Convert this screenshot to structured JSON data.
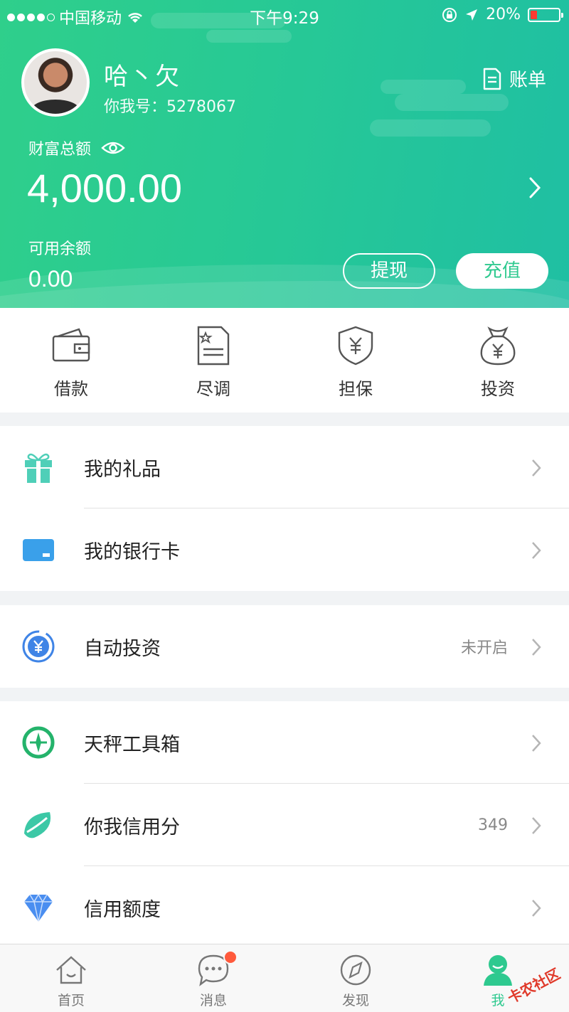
{
  "status_bar": {
    "carrier": "中国移动",
    "time": "下午9:29",
    "battery": "20%"
  },
  "profile": {
    "username": "哈丶欠",
    "user_id": "你我号：5278067",
    "bill_label": "账单"
  },
  "wealth": {
    "label": "财富总额",
    "amount": "4,000.00",
    "available_label": "可用余额",
    "available_amount": "0.00"
  },
  "actions": {
    "withdraw": "提现",
    "recharge": "充值"
  },
  "quick_actions": [
    {
      "label": "借款",
      "icon": "wallet-icon"
    },
    {
      "label": "尽调",
      "icon": "document-star-icon"
    },
    {
      "label": "担保",
      "icon": "shield-yuan-icon"
    },
    {
      "label": "投资",
      "icon": "money-bag-icon"
    }
  ],
  "menu_groups": [
    [
      {
        "label": "我的礼品",
        "icon": "gift-icon",
        "value": ""
      },
      {
        "label": "我的银行卡",
        "icon": "bank-card-icon",
        "value": ""
      }
    ],
    [
      {
        "label": "自动投资",
        "icon": "auto-invest-icon",
        "value": "未开启"
      }
    ],
    [
      {
        "label": "天秤工具箱",
        "icon": "toolbox-icon",
        "value": ""
      },
      {
        "label": "你我信用分",
        "icon": "leaf-icon",
        "value": "349"
      },
      {
        "label": "信用额度",
        "icon": "diamond-icon",
        "value": ""
      }
    ]
  ],
  "tabs": [
    {
      "label": "首页",
      "icon": "home-icon",
      "active": false
    },
    {
      "label": "消息",
      "icon": "message-icon",
      "active": false,
      "badge": true
    },
    {
      "label": "发现",
      "icon": "compass-icon",
      "active": false
    },
    {
      "label": "我",
      "icon": "profile-icon",
      "active": true
    }
  ],
  "watermark": "卡农社区",
  "colors": {
    "accent": "#2ec98f",
    "badge": "#ff5a3c",
    "battery_low": "#ff3b30"
  }
}
